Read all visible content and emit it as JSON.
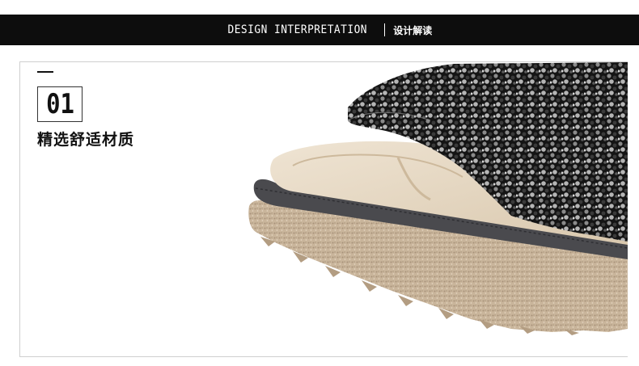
{
  "header": {
    "title_en": "DESIGN INTERPRETATION",
    "title_cn": "设计解读"
  },
  "section": {
    "number": "01",
    "subtitle": "精选舒适材质"
  },
  "colors": {
    "bar": "#0d0d0d",
    "sole": "#c8b49a",
    "insole": "#e6d9c6",
    "rim": "#4a4a4e",
    "sequin": "#1a1a1a"
  }
}
